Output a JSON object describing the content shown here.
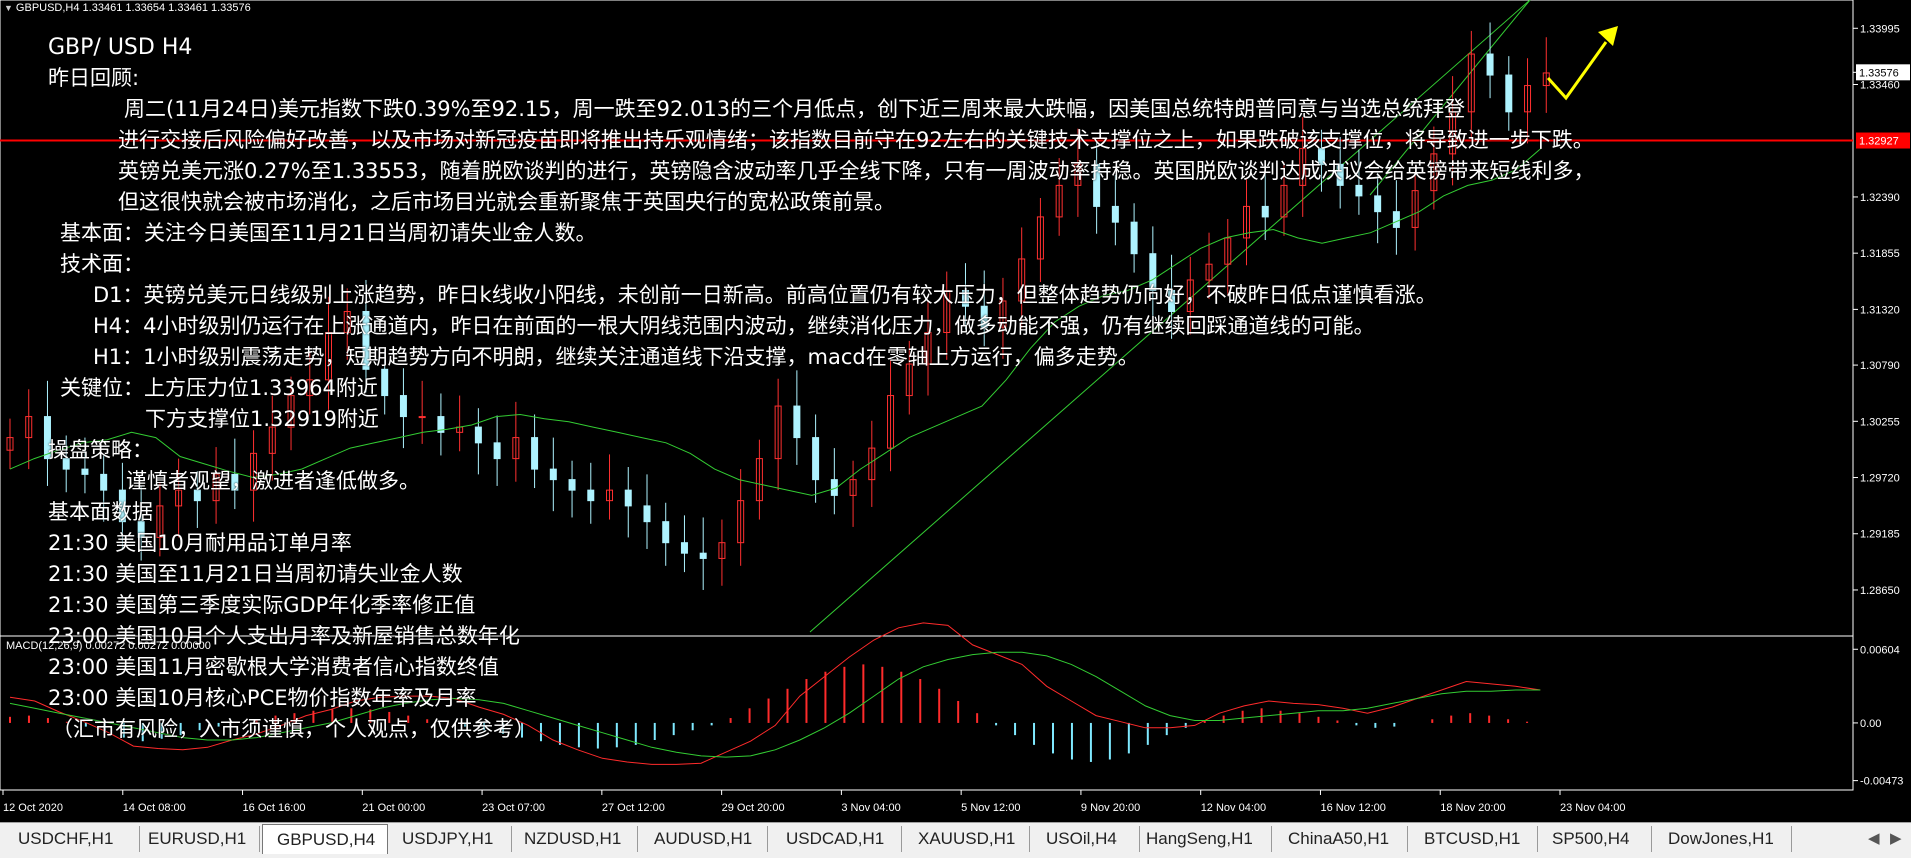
{
  "window": {
    "header": "GBPUSD,H4  1.33461 1.33654 1.33461 1.33576",
    "macd_label": "MACD(12,26,9) 0.00272 0.00272 0.00000"
  },
  "overlay": {
    "title": "GBP/ USD  H4",
    "review_heading": "昨日回顾:",
    "review_p1": "周二(11月24日)美元指数下跌0.39%至92.15，周一跌至92.013的三个月低点，创下近三周来最大跌幅，因美国总统特朗普同意与当选总统拜登",
    "review_p2": "进行交接后风险偏好改善，以及市场对新冠疫苗即将推出持乐观情绪；该指数目前守在92左右的关键技术支撑位之上，如果跌破该支撑位，将导致进一步下跌。",
    "review_p3": "英镑兑美元涨0.27%至1.33553，随着脱欧谈判的进行，英镑隐含波动率几乎全线下降，只有一周波动率持稳。英国脱欧谈判达成决议会给英镑带来短线利多，",
    "review_p4": "但这很快就会被市场消化，之后市场目光就会重新聚焦于英国央行的宽松政策前景。",
    "fundamental": "基本面：关注今日美国至11月21日当周初请失业金人数。",
    "technical": "技术面：",
    "d1": "D1：英镑兑美元日线级别上涨趋势，昨日k线收小阳线，未创前一日新高。前高位置仍有较大压力，但整体趋势仍向好，不破昨日低点谨慎看涨。",
    "h4": "H4：4小时级别仍运行在上涨通道内，昨日在前面的一根大阴线范围内波动，继续消化压力，做多动能不强，仍有继续回踩通道线的可能。",
    "h1": "H1：1小时级别震荡走势，短期趋势方向不明朗，继续关注通道线下沿支撑，macd在零轴上方运行，偏多走势。",
    "key_level_1": "关键位：上方压力位1.33964附近",
    "key_level_2": "下方支撑位1.32919附近",
    "strategy_heading": "操盘策略：",
    "strategy": "谨慎者观望，激进者逢低做多。",
    "data_heading": "基本面数据",
    "events": [
      "21:30 美国10月耐用品订单月率",
      "21:30 美国至11月21日当周初请失业金人数",
      "21:30 美国第三季度实际GDP年化季率修正值",
      "23:00 美国10月个人支出月率及新屋销售总数年化",
      "23:00 美国11月密歇根大学消费者信心指数终值",
      "23:00 美国10月核心PCE物价指数年率及月率"
    ],
    "disclaimer": "（汇市有风险，入市须谨慎，个人观点，仅供参考）"
  },
  "tabs": [
    {
      "label": "USDCHF,H1",
      "active": false
    },
    {
      "label": "EURUSD,H1",
      "active": false
    },
    {
      "label": "GBPUSD,H4",
      "active": true
    },
    {
      "label": "USDJPY,H1",
      "active": false
    },
    {
      "label": "NZDUSD,H1",
      "active": false
    },
    {
      "label": "AUDUSD,H1",
      "active": false
    },
    {
      "label": "USDCAD,H1",
      "active": false
    },
    {
      "label": "XAUUSD,H1",
      "active": false
    },
    {
      "label": "USOil,H4",
      "active": false
    },
    {
      "label": "HangSeng,H1",
      "active": false
    },
    {
      "label": "ChinaA50,H1",
      "active": false
    },
    {
      "label": "BTCUSD,H1",
      "active": false
    },
    {
      "label": "SP500,H4",
      "active": false
    },
    {
      "label": "DowJones,H1",
      "active": false
    }
  ],
  "tab_nav": {
    "left_icon": "triangle-left",
    "right_icon": "triangle-right",
    "left_glyph": "◀",
    "right_glyph": "▶"
  },
  "colors": {
    "background": "#000000",
    "bull_candle": "#ff3030",
    "bear_candle": "#aef3ff",
    "ma_line": "#33cc33",
    "channel_line": "#33cc33",
    "resistance_line": "#ff0000",
    "macd_positive": "#ff2b2b",
    "macd_negative": "#7fe9ff",
    "macd_line": "#ff2b2b",
    "signal_line": "#33cc33",
    "arrow": "#ffff00",
    "price_box": "#ffffff",
    "hline_box": "#ff0000"
  },
  "chart_data": {
    "type": "candlestick",
    "symbol": "GBPUSD",
    "timeframe": "H4",
    "ohlc_header": {
      "open": 1.33461,
      "high": 1.33654,
      "low": 1.33461,
      "close": 1.33576
    },
    "x_ticks": [
      "12 Oct 2020",
      "14 Oct 08:00",
      "16 Oct 16:00",
      "21 Oct 00:00",
      "23 Oct 07:00",
      "27 Oct 12:00",
      "29 Oct 20:00",
      "3 Nov 04:00",
      "5 Nov 12:00",
      "9 Nov 20:00",
      "12 Nov 04:00",
      "16 Nov 12:00",
      "18 Nov 20:00",
      "23 Nov 04:00"
    ],
    "y_ticks": [
      "1.33995",
      "1.33460",
      "1.32390",
      "1.31855",
      "1.31320",
      "1.30790",
      "1.30255",
      "1.29720",
      "1.29185",
      "1.28650"
    ],
    "ylim": [
      1.2825,
      1.3415
    ],
    "current_price": "1.33576",
    "horizontal_line": "1.32927",
    "closes_approx": [
      1.301,
      1.303,
      1.299,
      1.298,
      1.2975,
      1.296,
      1.293,
      1.2915,
      1.2945,
      1.296,
      1.295,
      1.2975,
      1.296,
      1.2995,
      1.302,
      1.305,
      1.3065,
      1.311,
      1.313,
      1.3075,
      1.305,
      1.303,
      1.303,
      1.3015,
      1.302,
      1.3005,
      1.299,
      1.301,
      1.298,
      1.297,
      1.296,
      1.295,
      1.296,
      1.2945,
      1.293,
      1.291,
      1.29,
      1.2895,
      1.291,
      1.295,
      1.299,
      1.304,
      1.301,
      1.297,
      1.2955,
      1.297,
      1.3,
      1.305,
      1.308,
      1.311,
      1.315,
      1.3135,
      1.3115,
      1.314,
      1.318,
      1.322,
      1.325,
      1.327,
      1.323,
      1.3215,
      1.3185,
      1.315,
      1.313,
      1.316,
      1.3175,
      1.32,
      1.323,
      1.322,
      1.325,
      1.3285,
      1.327,
      1.325,
      1.324,
      1.3225,
      1.321,
      1.3245,
      1.328,
      1.332,
      1.3375,
      1.3355,
      1.332,
      1.3345,
      1.3357
    ],
    "ma_approx": [
      1.298,
      1.299,
      1.2998,
      1.3005,
      1.3008,
      1.3015,
      1.301,
      1.2992,
      1.2985,
      1.2978,
      1.2972,
      1.2975,
      1.298,
      1.299,
      1.3,
      1.3005,
      1.301,
      1.3015,
      1.3018,
      1.3022,
      1.303,
      1.3032,
      1.3028,
      1.3025,
      1.302,
      1.3015,
      1.301,
      1.3005,
      1.2995,
      1.298,
      1.297,
      1.2965,
      1.296,
      1.2955,
      1.2962,
      1.298,
      1.2995,
      1.301,
      1.302,
      1.303,
      1.304,
      1.3065,
      1.3095,
      1.312,
      1.3135,
      1.3145,
      1.315,
      1.316,
      1.3175,
      1.319,
      1.32,
      1.3205,
      1.3208,
      1.32,
      1.3195,
      1.32,
      1.3205,
      1.3215,
      1.3225,
      1.324,
      1.325,
      1.3255,
      1.3265,
      1.3285
    ],
    "macd": {
      "label": "MACD(12,26,9) 0.00272 0.00272 0.00000",
      "y_ticks": [
        "0.00604",
        "0.00",
        "-0.00473"
      ],
      "ylim": [
        -0.0055,
        0.0068
      ],
      "histogram_approx": [
        0.0005,
        0.0006,
        0.0004,
        0.0001,
        -0.0003,
        -0.0008,
        -0.0012,
        -0.0015,
        -0.0013,
        -0.001,
        -0.0006,
        -0.0003,
        0.0,
        0.0003,
        0.0006,
        0.0008,
        0.001,
        0.0011,
        0.0012,
        0.0011,
        0.0009,
        0.0006,
        0.0003,
        0.0,
        -0.0003,
        -0.0006,
        -0.0009,
        -0.0012,
        -0.0015,
        -0.0018,
        -0.002,
        -0.0021,
        -0.002,
        -0.0018,
        -0.0014,
        -0.001,
        -0.0006,
        -0.0002,
        0.0004,
        0.0012,
        0.002,
        0.0028,
        0.0036,
        0.0042,
        0.0046,
        0.0048,
        0.0046,
        0.0042,
        0.0036,
        0.0028,
        0.0018,
        0.0008,
        -0.0002,
        -0.001,
        -0.0018,
        -0.0025,
        -0.003,
        -0.0032,
        -0.003,
        -0.0025,
        -0.0018,
        -0.001,
        -0.0004,
        0.0002,
        0.0006,
        0.001,
        0.0012,
        0.001,
        0.0008,
        0.0005,
        0.0002,
        -0.0002,
        -0.0004,
        -0.0003,
        0.0,
        0.0003,
        0.0006,
        0.0008,
        0.0006,
        0.0003,
        0.0001,
        0.0
      ],
      "signal_approx": [
        0.0016,
        0.0012,
        0.0008,
        0.0004,
        0.0,
        -0.0004,
        -0.0008,
        -0.0012,
        -0.0014,
        -0.0014,
        -0.0012,
        -0.0008,
        -0.0004,
        0.0,
        0.0006,
        0.0012,
        0.0016,
        0.0019,
        0.002,
        0.0019,
        0.0016,
        0.001,
        0.0004,
        -0.0002,
        -0.0008,
        -0.0014,
        -0.002,
        -0.0024,
        -0.0027,
        -0.0028,
        -0.0027,
        -0.0022,
        -0.0014,
        -0.0004,
        0.0008,
        0.0022,
        0.0036,
        0.0046,
        0.0052,
        0.0056,
        0.0058,
        0.0058,
        0.0055,
        0.0048,
        0.0038,
        0.0026,
        0.0014,
        0.0006,
        0.0002,
        0.0002,
        0.0004,
        0.0006,
        0.0008,
        0.001,
        0.001,
        0.0012,
        0.0016,
        0.002,
        0.0024,
        0.0026,
        0.0026,
        0.0027,
        0.0027
      ]
    }
  }
}
